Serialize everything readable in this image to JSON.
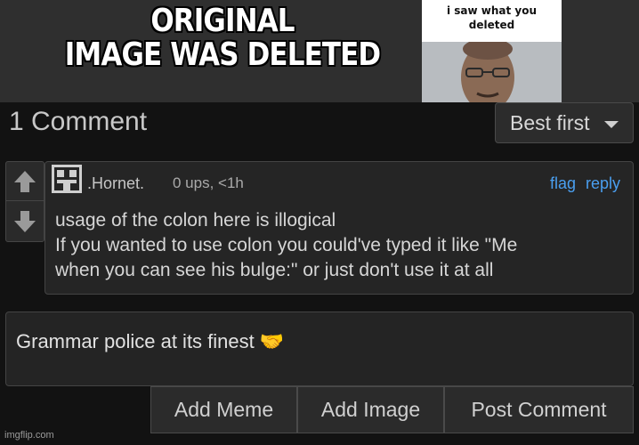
{
  "meme": {
    "caption_line1": "ORIGINAL",
    "caption_line2": "IMAGE WAS DELETED",
    "inset_caption_line1": "i saw what you",
    "inset_caption_line2": "deleted"
  },
  "comments_section": {
    "count_label": "1 Comment",
    "sort_label": "Best first",
    "sort_icon": "caret-down-icon"
  },
  "comment": {
    "username": ".Hornet.",
    "meta": "0 ups, <1h",
    "flag_label": "flag",
    "reply_label": "reply",
    "upvote_icon": "arrow-up-icon",
    "downvote_icon": "arrow-down-icon",
    "text_lines": [
      "usage of the colon here is illogical",
      "If you wanted to use colon you could've typed it like \"Me",
      "when you can see his bulge:\" or just don't use it at all"
    ]
  },
  "reply_box": {
    "text": "Grammar police at its finest",
    "emoji": "🤝"
  },
  "buttons": {
    "add_meme": "Add Meme",
    "add_image": "Add Image",
    "post_comment": "Post Comment"
  },
  "watermark": "imgflip.com",
  "colors": {
    "link": "#4a9ff0",
    "background": "#121212",
    "card": "#252525"
  }
}
